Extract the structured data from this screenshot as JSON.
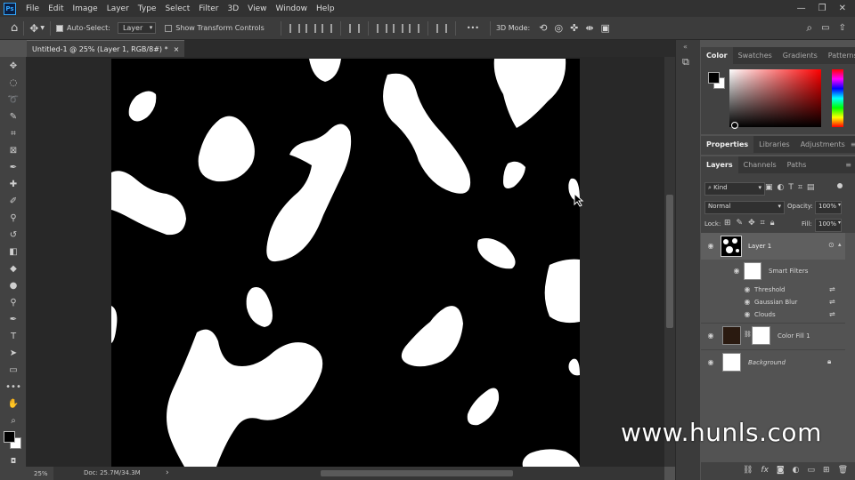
{
  "app": {
    "logo": "Ps"
  },
  "menubar": {
    "items": [
      "File",
      "Edit",
      "Image",
      "Layer",
      "Type",
      "Select",
      "Filter",
      "3D",
      "View",
      "Window",
      "Help"
    ],
    "window_controls": [
      "—",
      "❐",
      "✕"
    ]
  },
  "options": {
    "auto_select_label": "Auto-Select:",
    "auto_select_value": "Layer",
    "show_transform_label": "Show Transform Controls",
    "mode_3d_label": "3D Mode:",
    "more": "•••"
  },
  "document": {
    "tab_title": "Untitled-1 @ 25% (Layer 1, RGB/8#) *",
    "close": "×"
  },
  "status": {
    "zoom": "25%",
    "doc_size": "Doc: 25.7M/34.3M",
    "arrow": "›"
  },
  "panels": {
    "color_tabs": [
      "Color",
      "Swatches",
      "Gradients",
      "Patterns"
    ],
    "props_tabs": [
      "Properties",
      "Libraries",
      "Adjustments"
    ],
    "layers_tabs": [
      "Layers",
      "Channels",
      "Paths"
    ],
    "filter_kind": "Kind",
    "blend_mode": "Normal",
    "opacity_label": "Opacity:",
    "opacity_value": "100%",
    "lock_label": "Lock:",
    "fill_label": "Fill:",
    "fill_value": "100%"
  },
  "layers": {
    "layer1": "Layer 1",
    "smart_filters": "Smart Filters",
    "filters": [
      "Threshold",
      "Gaussian Blur",
      "Clouds"
    ],
    "color_fill": "Color Fill 1",
    "background": "Background"
  },
  "watermark": "www.hunls.com",
  "colors": {
    "accent": "#31a8ff",
    "panel_bg": "#424242",
    "menubar_bg": "#323232",
    "canvas_bg": "#282828",
    "foreground": "#000000",
    "background": "#ffffff"
  }
}
